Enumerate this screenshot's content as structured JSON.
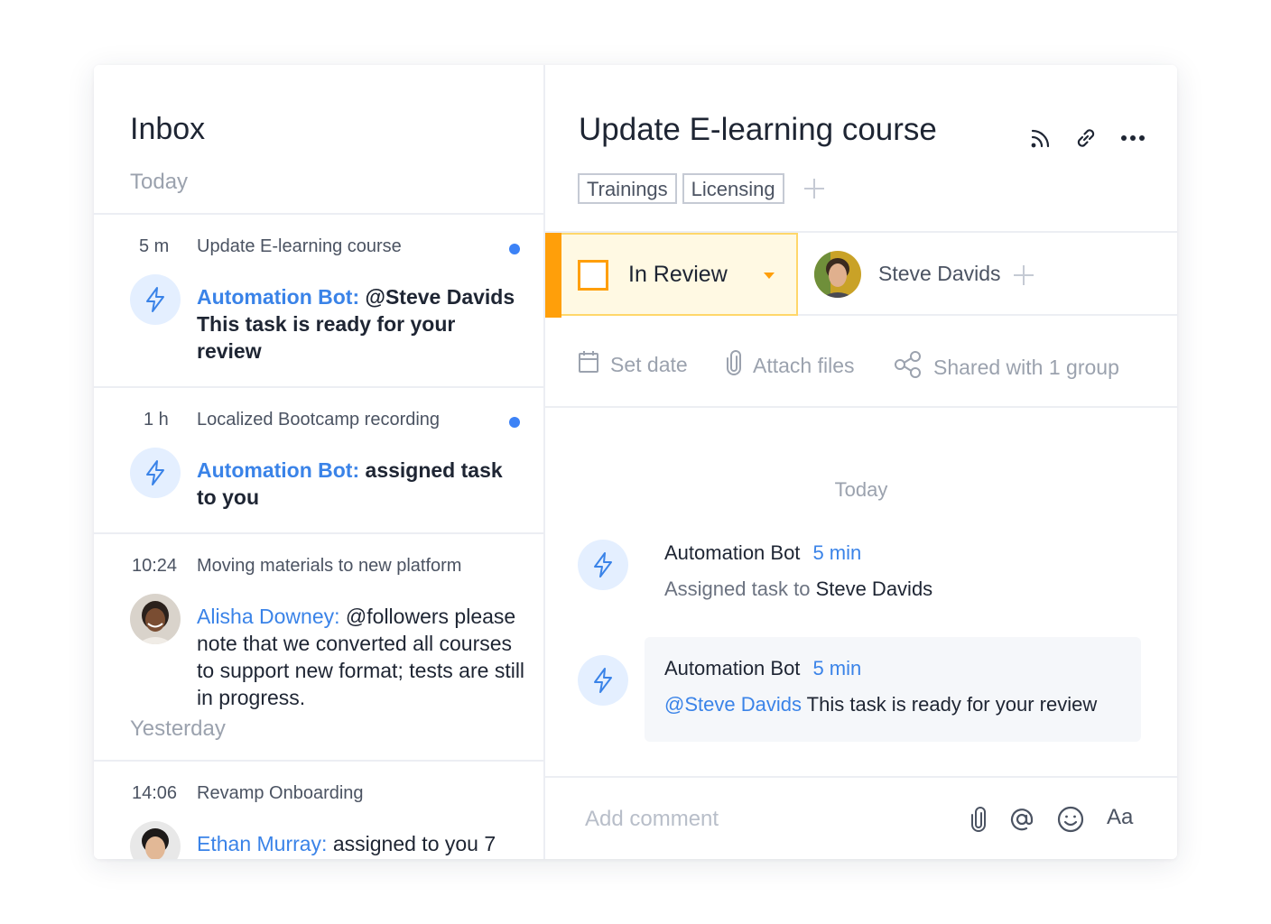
{
  "inbox": {
    "title": "Inbox",
    "sections": {
      "today": "Today",
      "yesterday": "Yesterday"
    },
    "items": [
      {
        "time": "5 m",
        "task": "Update E-learning course",
        "author": "Automation Bot:",
        "text": "@Steve Davids This task is ready for your review",
        "unread": true,
        "avatar": "lightning-icon"
      },
      {
        "time": "1 h",
        "task": "Localized Bootcamp recording",
        "author": "Automation Bot:",
        "text": "assigned task to you",
        "unread": true,
        "avatar": "lightning-icon"
      },
      {
        "time": "10:24",
        "task": "Moving materials to new platform",
        "author": "Alisha Downey:",
        "text": "@followers please note that we converted all courses to support new format; tests are still in progress.",
        "unread": false,
        "avatar": "user-photo"
      },
      {
        "time": "14:06",
        "task": "Revamp Onboarding",
        "author": "Ethan Murray:",
        "text": "assigned to you 7",
        "unread": false,
        "avatar": "user-photo"
      }
    ]
  },
  "task": {
    "title": "Update E-learning course",
    "tags": [
      "Trainings",
      "Licensing"
    ],
    "status": "In Review",
    "assignee": "Steve Davids",
    "meta": {
      "set_date": "Set date",
      "attach_files": "Attach files",
      "shared": "Shared with 1 group"
    }
  },
  "feed": {
    "day_label": "Today",
    "comments": [
      {
        "author": "Automation Bot",
        "time": "5 min",
        "prefix": "Assigned task to",
        "target": "Steve Davids"
      },
      {
        "author": "Automation Bot",
        "time": "5 min",
        "mention": "@Steve Davids",
        "text": "This task is ready for your review"
      }
    ]
  },
  "composer": {
    "placeholder": "Add comment",
    "format_label": "Aa"
  },
  "colors": {
    "accent": "#3a83e8",
    "status": "#ff9f0a",
    "unread_dot": "#3c82f6"
  }
}
